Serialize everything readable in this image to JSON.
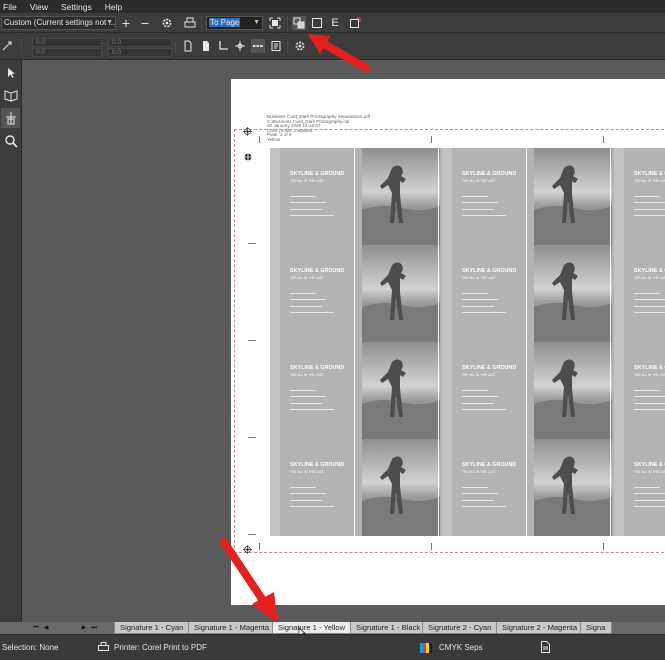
{
  "menu": {
    "items": [
      "File",
      "View",
      "Settings",
      "Help"
    ]
  },
  "toolbar": {
    "preset_value": "Custom (Current settings not ...",
    "zoom_value": "To Page"
  },
  "toolbar2": {
    "field_values": [
      "0.0",
      "0.0",
      "0.0",
      "0.0"
    ]
  },
  "page": {
    "info_lines": [
      "Business Card_Dark Photography Separations.pdf",
      "C:\\Business Card_Dark Photography.cdr",
      "20 January 2020 14:15:57",
      "Color profile: Disabled",
      "Plate: 3 of 5",
      "Yellow"
    ]
  },
  "card": {
    "brand": "SKYLINE & GROUND",
    "tagline": "THE ALL IN THE LAST"
  },
  "tabs": [
    "Signature 1 - Cyan",
    "Signature 1 - Magenta",
    "Signature 1 - Yellow",
    "Signature 1 - Black",
    "Signature 2 - Cyan",
    "Signature 2 - Magenta",
    "Signa"
  ],
  "active_tab": "Signature 1 - Yellow",
  "status": {
    "selection": "Selection: None",
    "printer": "Printer: Corel Print to PDF",
    "separations": "CMYK Seps"
  },
  "colors": {
    "arrow": "#e8201d",
    "crop_marks": "#c88a9a",
    "workspace": "#5a5a5a"
  }
}
